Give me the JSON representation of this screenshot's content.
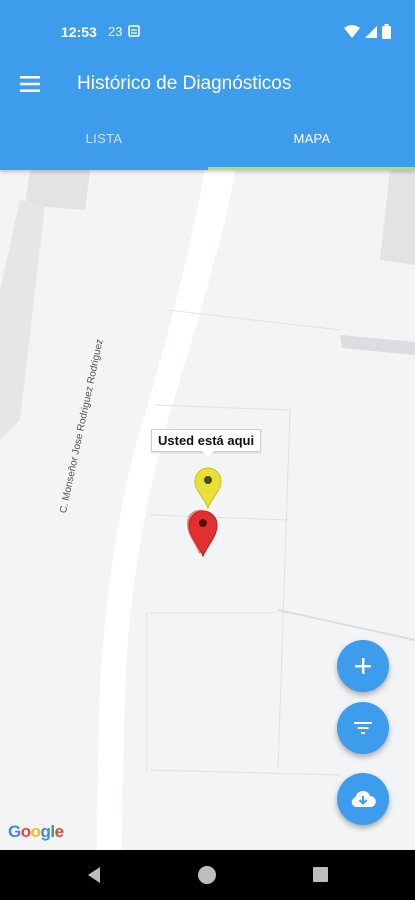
{
  "status_bar": {
    "time": "12:53",
    "extra": "23",
    "icons": [
      "calendar-icon",
      "wifi-icon",
      "signal-icon",
      "battery-icon"
    ]
  },
  "app_bar": {
    "title": "Histórico de Diagnósticos",
    "menu_icon": "hamburger-menu-icon"
  },
  "tabs": [
    {
      "label": "LISTA",
      "selected": false
    },
    {
      "label": "MAPA",
      "selected": true
    }
  ],
  "map": {
    "street_label": "C. Monseñor Jose Rodriguez Rodriguez",
    "tooltip": "Usted está aqui",
    "markers": [
      {
        "color": "#e8e037",
        "meaning": "current-location"
      },
      {
        "color": "#e0312f",
        "meaning": "diagnostic"
      }
    ],
    "attribution": "Google"
  },
  "fabs": [
    {
      "name": "add-button",
      "icon": "plus-icon"
    },
    {
      "name": "filter-button",
      "icon": "filter-icon"
    },
    {
      "name": "download-button",
      "icon": "cloud-download-icon"
    }
  ],
  "colors": {
    "primary": "#3e9ced",
    "tab_indicator": "#b8dc6b",
    "marker_yellow": "#e8e037",
    "marker_red": "#e0312f"
  }
}
